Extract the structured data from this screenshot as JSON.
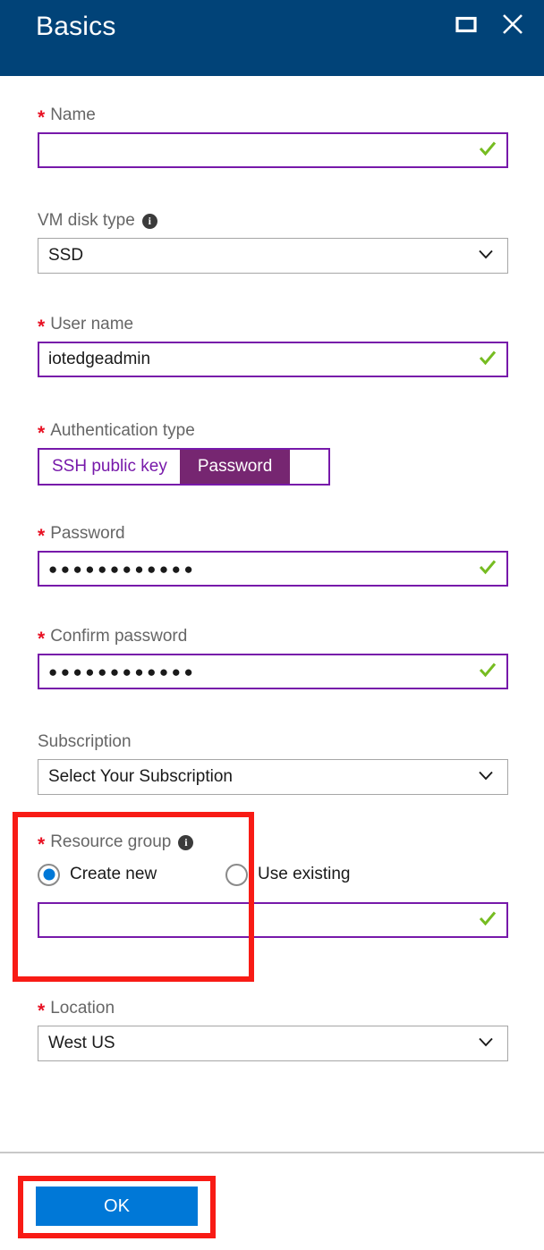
{
  "header": {
    "title": "Basics",
    "maximize_icon": "maximize-icon",
    "close_icon": "close-icon",
    "background_color": "#014378"
  },
  "colors": {
    "header_blue": "#014378",
    "valid_border_purple": "#7719aa",
    "toggle_selected_purple": "#762671",
    "check_green": "#76bc21",
    "radio_blue": "#0078d7",
    "required_red": "#e81123",
    "annotation_red": "#f81b15",
    "ok_button_blue": "#0078d7",
    "label_gray": "#666666",
    "dropdown_border_gray": "#a6a6a6"
  },
  "fields": {
    "name": {
      "label": "Name",
      "required": true,
      "value": "",
      "valid_icon": "checkmark-icon"
    },
    "vm_disk_type": {
      "label": "VM disk type",
      "required": false,
      "info_icon": "info-icon",
      "value": "SSD",
      "chevron_icon": "chevron-down-icon"
    },
    "user_name": {
      "label": "User name",
      "required": true,
      "value": "iotedgeadmin",
      "valid_icon": "checkmark-icon"
    },
    "authentication_type": {
      "label": "Authentication type",
      "required": true,
      "options": [
        {
          "label": "SSH public key",
          "selected": false
        },
        {
          "label": "Password",
          "selected": true
        }
      ]
    },
    "password": {
      "label": "Password",
      "required": true,
      "value": "●●●●●●●●●●●●",
      "valid_icon": "checkmark-icon"
    },
    "confirm_password": {
      "label": "Confirm password",
      "required": true,
      "value": "●●●●●●●●●●●●",
      "valid_icon": "checkmark-icon"
    },
    "subscription": {
      "label": "Subscription",
      "required": false,
      "value": "Select Your Subscription",
      "chevron_icon": "chevron-down-icon"
    },
    "resource_group": {
      "label": "Resource group",
      "required": true,
      "info_icon": "info-icon",
      "options": [
        {
          "label": "Create new",
          "selected": true
        },
        {
          "label": "Use existing",
          "selected": false
        }
      ],
      "value": "",
      "valid_icon": "checkmark-icon"
    },
    "location": {
      "label": "Location",
      "required": true,
      "value": "West US",
      "chevron_icon": "chevron-down-icon"
    }
  },
  "footer": {
    "ok_label": "OK"
  }
}
